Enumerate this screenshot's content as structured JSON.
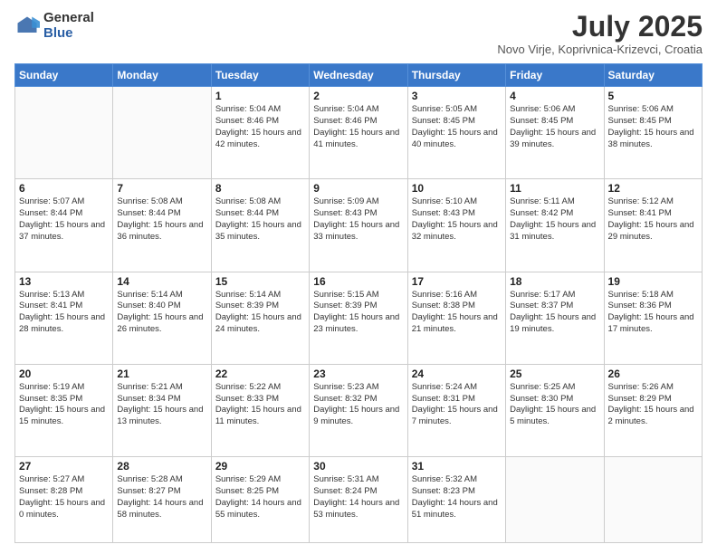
{
  "logo": {
    "general": "General",
    "blue": "Blue"
  },
  "title": "July 2025",
  "subtitle": "Novo Virje, Koprivnica-Krizevci, Croatia",
  "days_of_week": [
    "Sunday",
    "Monday",
    "Tuesday",
    "Wednesday",
    "Thursday",
    "Friday",
    "Saturday"
  ],
  "weeks": [
    [
      {
        "day": "",
        "info": ""
      },
      {
        "day": "",
        "info": ""
      },
      {
        "day": "1",
        "info": "Sunrise: 5:04 AM\nSunset: 8:46 PM\nDaylight: 15 hours and 42 minutes."
      },
      {
        "day": "2",
        "info": "Sunrise: 5:04 AM\nSunset: 8:46 PM\nDaylight: 15 hours and 41 minutes."
      },
      {
        "day": "3",
        "info": "Sunrise: 5:05 AM\nSunset: 8:45 PM\nDaylight: 15 hours and 40 minutes."
      },
      {
        "day": "4",
        "info": "Sunrise: 5:06 AM\nSunset: 8:45 PM\nDaylight: 15 hours and 39 minutes."
      },
      {
        "day": "5",
        "info": "Sunrise: 5:06 AM\nSunset: 8:45 PM\nDaylight: 15 hours and 38 minutes."
      }
    ],
    [
      {
        "day": "6",
        "info": "Sunrise: 5:07 AM\nSunset: 8:44 PM\nDaylight: 15 hours and 37 minutes."
      },
      {
        "day": "7",
        "info": "Sunrise: 5:08 AM\nSunset: 8:44 PM\nDaylight: 15 hours and 36 minutes."
      },
      {
        "day": "8",
        "info": "Sunrise: 5:08 AM\nSunset: 8:44 PM\nDaylight: 15 hours and 35 minutes."
      },
      {
        "day": "9",
        "info": "Sunrise: 5:09 AM\nSunset: 8:43 PM\nDaylight: 15 hours and 33 minutes."
      },
      {
        "day": "10",
        "info": "Sunrise: 5:10 AM\nSunset: 8:43 PM\nDaylight: 15 hours and 32 minutes."
      },
      {
        "day": "11",
        "info": "Sunrise: 5:11 AM\nSunset: 8:42 PM\nDaylight: 15 hours and 31 minutes."
      },
      {
        "day": "12",
        "info": "Sunrise: 5:12 AM\nSunset: 8:41 PM\nDaylight: 15 hours and 29 minutes."
      }
    ],
    [
      {
        "day": "13",
        "info": "Sunrise: 5:13 AM\nSunset: 8:41 PM\nDaylight: 15 hours and 28 minutes."
      },
      {
        "day": "14",
        "info": "Sunrise: 5:14 AM\nSunset: 8:40 PM\nDaylight: 15 hours and 26 minutes."
      },
      {
        "day": "15",
        "info": "Sunrise: 5:14 AM\nSunset: 8:39 PM\nDaylight: 15 hours and 24 minutes."
      },
      {
        "day": "16",
        "info": "Sunrise: 5:15 AM\nSunset: 8:39 PM\nDaylight: 15 hours and 23 minutes."
      },
      {
        "day": "17",
        "info": "Sunrise: 5:16 AM\nSunset: 8:38 PM\nDaylight: 15 hours and 21 minutes."
      },
      {
        "day": "18",
        "info": "Sunrise: 5:17 AM\nSunset: 8:37 PM\nDaylight: 15 hours and 19 minutes."
      },
      {
        "day": "19",
        "info": "Sunrise: 5:18 AM\nSunset: 8:36 PM\nDaylight: 15 hours and 17 minutes."
      }
    ],
    [
      {
        "day": "20",
        "info": "Sunrise: 5:19 AM\nSunset: 8:35 PM\nDaylight: 15 hours and 15 minutes."
      },
      {
        "day": "21",
        "info": "Sunrise: 5:21 AM\nSunset: 8:34 PM\nDaylight: 15 hours and 13 minutes."
      },
      {
        "day": "22",
        "info": "Sunrise: 5:22 AM\nSunset: 8:33 PM\nDaylight: 15 hours and 11 minutes."
      },
      {
        "day": "23",
        "info": "Sunrise: 5:23 AM\nSunset: 8:32 PM\nDaylight: 15 hours and 9 minutes."
      },
      {
        "day": "24",
        "info": "Sunrise: 5:24 AM\nSunset: 8:31 PM\nDaylight: 15 hours and 7 minutes."
      },
      {
        "day": "25",
        "info": "Sunrise: 5:25 AM\nSunset: 8:30 PM\nDaylight: 15 hours and 5 minutes."
      },
      {
        "day": "26",
        "info": "Sunrise: 5:26 AM\nSunset: 8:29 PM\nDaylight: 15 hours and 2 minutes."
      }
    ],
    [
      {
        "day": "27",
        "info": "Sunrise: 5:27 AM\nSunset: 8:28 PM\nDaylight: 15 hours and 0 minutes."
      },
      {
        "day": "28",
        "info": "Sunrise: 5:28 AM\nSunset: 8:27 PM\nDaylight: 14 hours and 58 minutes."
      },
      {
        "day": "29",
        "info": "Sunrise: 5:29 AM\nSunset: 8:25 PM\nDaylight: 14 hours and 55 minutes."
      },
      {
        "day": "30",
        "info": "Sunrise: 5:31 AM\nSunset: 8:24 PM\nDaylight: 14 hours and 53 minutes."
      },
      {
        "day": "31",
        "info": "Sunrise: 5:32 AM\nSunset: 8:23 PM\nDaylight: 14 hours and 51 minutes."
      },
      {
        "day": "",
        "info": ""
      },
      {
        "day": "",
        "info": ""
      }
    ]
  ]
}
